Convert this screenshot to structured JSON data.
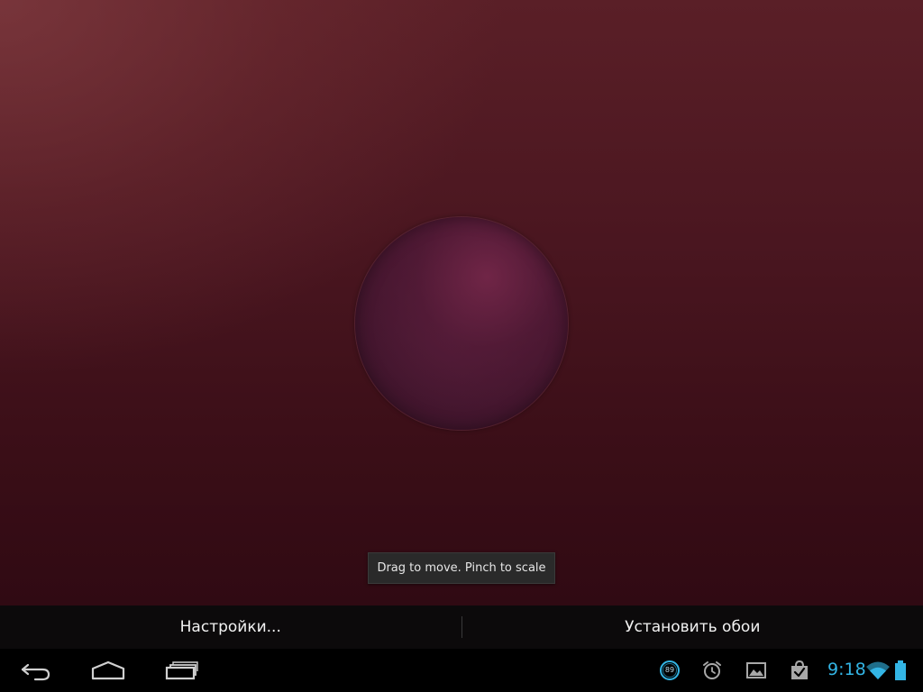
{
  "toast": {
    "text": "Drag to move. Pinch to scale"
  },
  "action_bar": {
    "settings_label": "Настройки...",
    "set_wallpaper_label": "Установить обои"
  },
  "system_bar": {
    "clock": "9:18",
    "notification_badge": "89",
    "icons": [
      "back-icon",
      "home-icon",
      "recent-apps-icon",
      "notification-badge-icon",
      "alarm-icon",
      "gallery-icon",
      "store-download-icon",
      "wifi-icon",
      "battery-icon"
    ]
  },
  "colors": {
    "accent": "#33b5e5",
    "wallpaper_top": "#5a1f27",
    "wallpaper_bottom": "#300a13",
    "orb": "#4b1a34"
  }
}
